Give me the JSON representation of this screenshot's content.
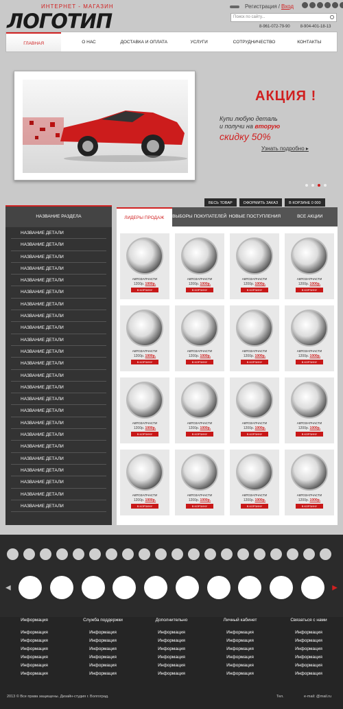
{
  "header": {
    "logo_sub": "ИНТЕРНЕТ - МАГАЗИН",
    "logo": "ЛОГОТИП",
    "register": "Регистрация",
    "slash": "/",
    "enter": "Вход",
    "search_placeholder": "Поиск по сайту...",
    "phone1": "8-961-072-79-90",
    "phone2": "8-904-401-18-13"
  },
  "nav": [
    "ГЛАВНАЯ",
    "О НАС",
    "ДОСТАВКА И ОПЛАТА",
    "УСЛУГИ",
    "СОТРУДНИЧЕСТВО",
    "КОНТАКТЫ"
  ],
  "promo": {
    "title": "АКЦИЯ !",
    "line1": "Купи любую деталь",
    "line2a": "и получи на",
    "line2b": "вторую",
    "line3": "скидку 50%",
    "learn_more": "Узнать подробно"
  },
  "toolbar": [
    "ВЕСЬ ТОВАР",
    "ОФОРМИТЬ ЗАКАЗ",
    "В КОРЗИНЕ 0 000"
  ],
  "sidebar": {
    "title": "НАЗВАНИЕ РАЗДЕЛА",
    "items": [
      "НАЗВАНИЕ ДЕТАЛИ",
      "НАЗВАНИЕ ДЕТАЛИ",
      "НАЗВАНИЕ ДЕТАЛИ",
      "НАЗВАНИЕ ДЕТАЛИ",
      "НАЗВАНИЕ ДЕТАЛИ",
      "НАЗВАНИЕ ДЕТАЛИ",
      "НАЗВАНИЕ ДЕТАЛИ",
      "НАЗВАНИЕ ДЕТАЛИ",
      "НАЗВАНИЕ ДЕТАЛИ",
      "НАЗВАНИЕ ДЕТАЛИ",
      "НАЗВАНИЕ ДЕТАЛИ",
      "НАЗВАНИЕ ДЕТАЛИ",
      "НАЗВАНИЕ ДЕТАЛИ",
      "НАЗВАНИЕ ДЕТАЛИ",
      "НАЗВАНИЕ ДЕТАЛИ",
      "НАЗВАНИЕ ДЕТАЛИ",
      "НАЗВАНИЕ ДЕТАЛИ",
      "НАЗВАНИЕ ДЕТАЛИ",
      "НАЗВАНИЕ ДЕТАЛИ",
      "НАЗВАНИЕ ДЕТАЛИ",
      "НАЗВАНИЕ ДЕТАЛИ",
      "НАЗВАНИЕ ДЕТАЛИ",
      "НАЗВАНИЕ ДЕТАЛИ",
      "НАЗВАНИЕ ДЕТАЛИ"
    ]
  },
  "tabs": [
    "ЛИДЕРЫ ПРОДАЖ",
    "ВЫБОРЫ ПОКУПАТЕЛЕЙ",
    "НОВЫЕ ПОСТУПЛЕНИЯ",
    "ВСЕ АКЦИИ"
  ],
  "product": {
    "name": "АВТОЗАПЧАСТИ",
    "old_price": "1200р.",
    "price": "1000р.",
    "button": "В КОРЗИНУ"
  },
  "footer": {
    "columns": [
      {
        "title": "Информация",
        "items": [
          "Информация",
          "Информация",
          "Информация",
          "Информация",
          "Информация",
          "Информация"
        ]
      },
      {
        "title": "Служба поддержки",
        "items": [
          "Информация",
          "Информация",
          "Информация",
          "Информация",
          "Информация",
          "Информация"
        ]
      },
      {
        "title": "Дополнительно",
        "items": [
          "Информация",
          "Информация",
          "Информация",
          "Информация",
          "Информация",
          "Информация"
        ]
      },
      {
        "title": "Личный кабинет",
        "items": [
          "Информация",
          "Информация",
          "Информация",
          "Информация",
          "Информация",
          "Информация"
        ]
      },
      {
        "title": "Связаться с нами",
        "items": [
          "Информация",
          "Информация",
          "Информация",
          "Информация",
          "Информация",
          "Информация"
        ]
      }
    ],
    "copyright": "2013 © Все права защищены. Дизайн-студия  г. Волгоград.",
    "tel": "Тел.",
    "email": "e-mail: @mail.ru"
  }
}
